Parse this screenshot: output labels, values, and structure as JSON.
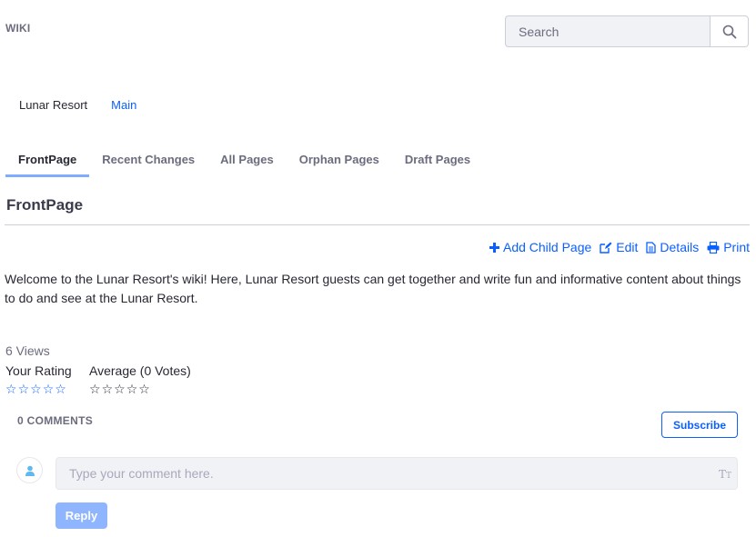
{
  "header": {
    "title": "WIKI"
  },
  "search": {
    "placeholder": "Search",
    "icon": "search-icon"
  },
  "breadcrumb": {
    "node": "Lunar Resort",
    "link": "Main"
  },
  "tabs": [
    {
      "label": "FrontPage",
      "active": true
    },
    {
      "label": "Recent Changes"
    },
    {
      "label": "All Pages"
    },
    {
      "label": "Orphan Pages"
    },
    {
      "label": "Draft Pages"
    }
  ],
  "page": {
    "title": "FrontPage",
    "content": "Welcome to the Lunar Resort's wiki! Here, Lunar Resort guests can get together and write fun and informative content about things to do and see at the Lunar Resort."
  },
  "actions": [
    {
      "label": "Add Child Page",
      "icon": "plus-icon"
    },
    {
      "label": "Edit",
      "icon": "edit-icon"
    },
    {
      "label": "Details",
      "icon": "document-icon"
    },
    {
      "label": "Print",
      "icon": "print-icon"
    }
  ],
  "stats": {
    "views": "6 Views",
    "your_rating_label": "Your Rating",
    "average_label": "Average (0 Votes)",
    "your_rating_value": 0,
    "average_value": 0,
    "max_stars": 5
  },
  "comments": {
    "count_label": "0 COMMENTS",
    "subscribe_label": "Subscribe",
    "placeholder": "Type your comment here.",
    "reply_label": "Reply"
  },
  "colors": {
    "accent": "#0b5fff",
    "tab_underline": "#80acff",
    "reply_disabled": "#90b5ff"
  }
}
